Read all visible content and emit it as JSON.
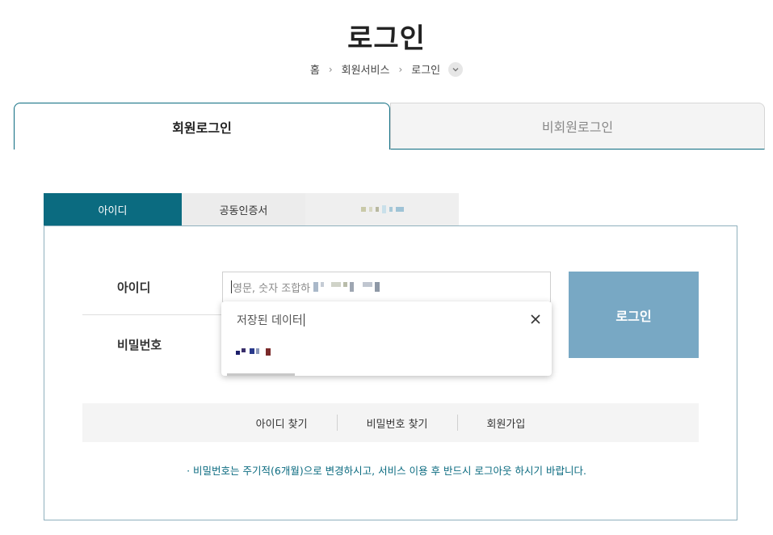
{
  "page": {
    "title": "로그인"
  },
  "breadcrumb": {
    "items": [
      "홈",
      "회원서비스",
      "로그인"
    ]
  },
  "main_tabs": {
    "member": "회원로그인",
    "guest": "비회원로그인"
  },
  "sub_tabs": {
    "id": "아이디",
    "cert": "공동인증서"
  },
  "form": {
    "id_label": "아이디",
    "pw_label": "비밀번호",
    "id_placeholder": "영문, 숫자 조합하",
    "login_button": "로그인"
  },
  "autocomplete": {
    "title": "저장된 데이터"
  },
  "links": {
    "find_id": "아이디 찾기",
    "find_pw": "비밀번호 찾기",
    "signup": "회원가입"
  },
  "notice": "· 비밀번호는 주기적(6개월)으로 변경하시고, 서비스 이용 후 반드시 로그아웃 하시기 바랍니다.",
  "colors": {
    "accent": "#0b6b80",
    "login_button": "#78a8c4",
    "border": "#8fb0bd"
  }
}
